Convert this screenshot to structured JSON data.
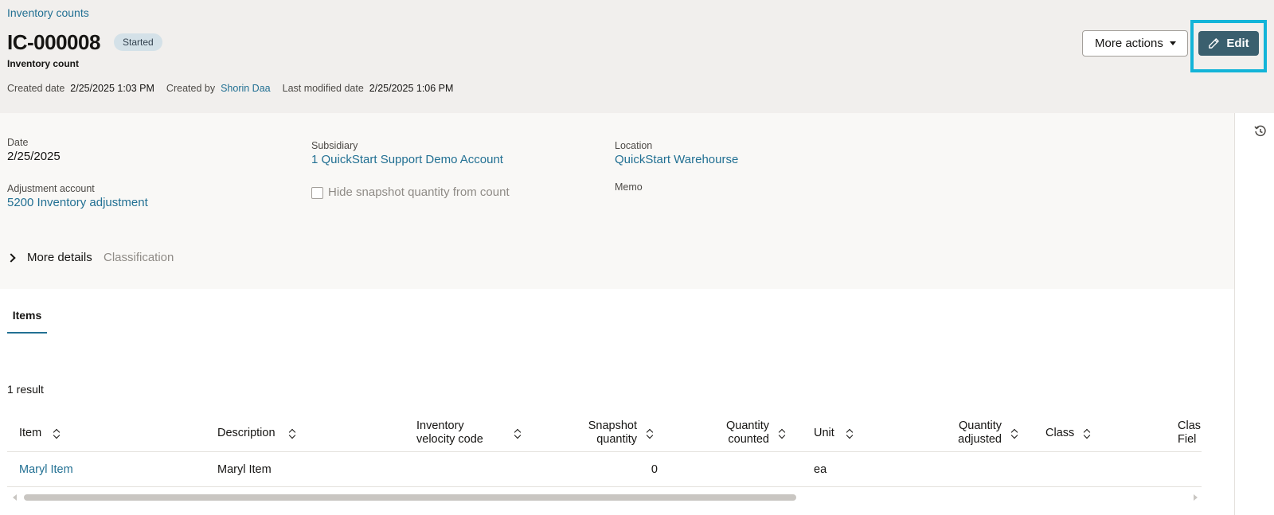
{
  "breadcrumb": "Inventory counts",
  "record": {
    "id": "IC-000008",
    "status": "Started",
    "type": "Inventory count",
    "created_date_label": "Created date",
    "created_date": "2/25/2025 1:03 PM",
    "created_by_label": "Created by",
    "created_by": "Shorin Daa",
    "modified_label": "Last modified date",
    "modified_date": "2/25/2025 1:06 PM"
  },
  "actions": {
    "more_actions": "More actions",
    "edit": "Edit"
  },
  "fields": {
    "date_label": "Date",
    "date": "2/25/2025",
    "subsidiary_label": "Subsidiary",
    "subsidiary": "1 QuickStart Support Demo Account",
    "location_label": "Location",
    "location": "QuickStart Warehourse",
    "adjustment_label": "Adjustment account",
    "adjustment": "5200 Inventory adjustment",
    "hide_snapshot_label": "Hide snapshot quantity from count",
    "hide_snapshot_checked": false,
    "memo_label": "Memo"
  },
  "sections": {
    "more_details": "More details",
    "classification": "Classification"
  },
  "tabs": {
    "items": "Items"
  },
  "table": {
    "result_count": "1 result",
    "columns": {
      "item": "Item",
      "description": "Description",
      "velocity_1": "Inventory",
      "velocity_2": "velocity code",
      "snapshot_1": "Snapshot",
      "snapshot_2": "quantity",
      "counted_1": "Quantity",
      "counted_2": "counted",
      "unit": "Unit",
      "adjusted_1": "Quantity",
      "adjusted_2": "adjusted",
      "class": "Class",
      "classfield_1": "Clas",
      "classfield_2": "Fiel"
    },
    "rows": [
      {
        "item": "Maryl Item",
        "description": "Maryl Item",
        "velocity": "",
        "snapshot": "0",
        "counted": "",
        "unit": "ea",
        "adjusted": "",
        "class": ""
      }
    ]
  },
  "colors": {
    "link": "#227093",
    "edit_button": "#3a5f6e",
    "highlight": "#13b4d8",
    "header_bg": "#f1efed"
  },
  "icons": [
    "pencil-icon",
    "caret-down-icon",
    "history-icon",
    "chevron-right-icon",
    "sort-icon"
  ]
}
